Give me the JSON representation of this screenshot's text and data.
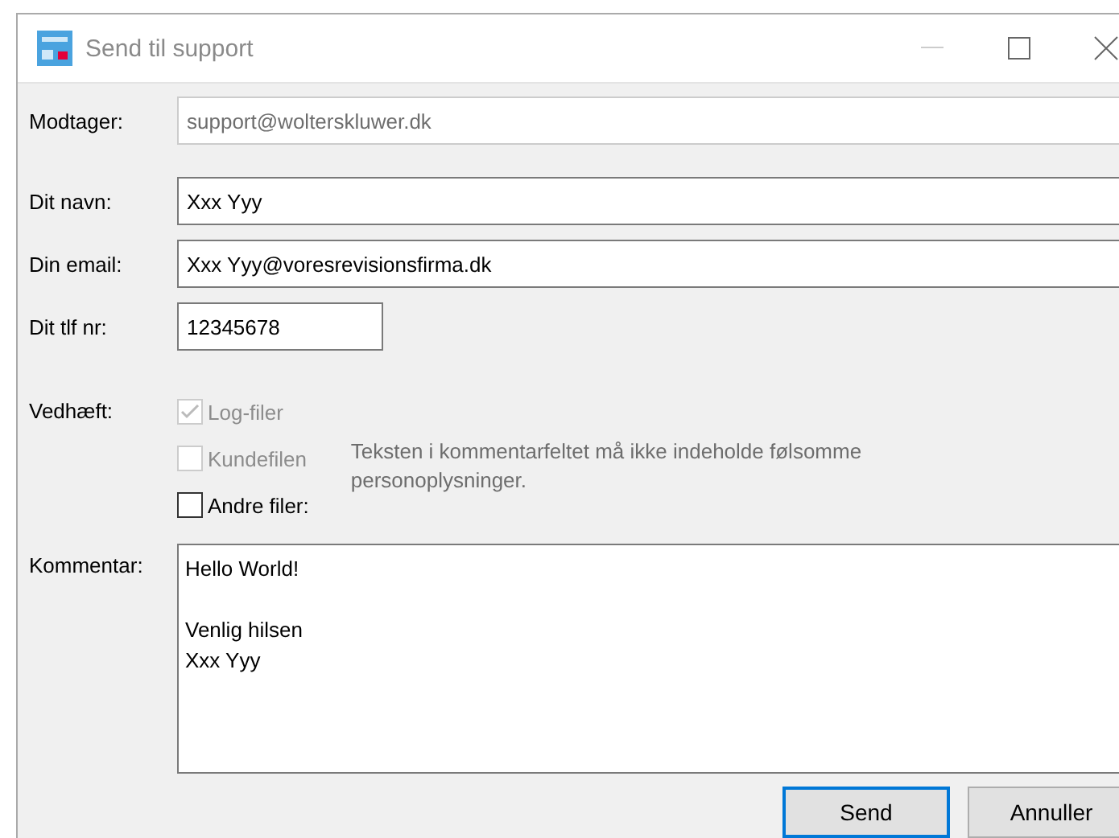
{
  "window": {
    "title": "Send til support"
  },
  "recipient": {
    "label": "Modtager:",
    "value": "support@wolterskluwer.dk",
    "disabled": true
  },
  "fields": [
    {
      "label": "Dit navn:",
      "value": "Xxx Yyy",
      "kind": "wide"
    },
    {
      "label": "Din email:",
      "value": "Xxx Yyy@voresrevisionsfirma.dk",
      "kind": "wide"
    },
    {
      "label": "Dit tlf nr:",
      "value": "12345678",
      "kind": "short"
    }
  ],
  "attach": {
    "label": "Vedhæft:",
    "options": [
      {
        "label": "Log-filer",
        "checked": true,
        "disabled": true
      },
      {
        "label": "Kundefilen",
        "checked": false,
        "disabled": true
      },
      {
        "label": "Andre filer:",
        "checked": false,
        "disabled": false
      }
    ],
    "note": "Teksten i kommentarfeltet må ikke indeholde følsomme personoplysninger."
  },
  "comment": {
    "label": "Kommentar:",
    "value": "Hello World!\n\nVenlig hilsen\nXxx Yyy"
  },
  "buttons": [
    {
      "label": "Send",
      "default": true
    },
    {
      "label": "Annuller",
      "default": false
    }
  ]
}
